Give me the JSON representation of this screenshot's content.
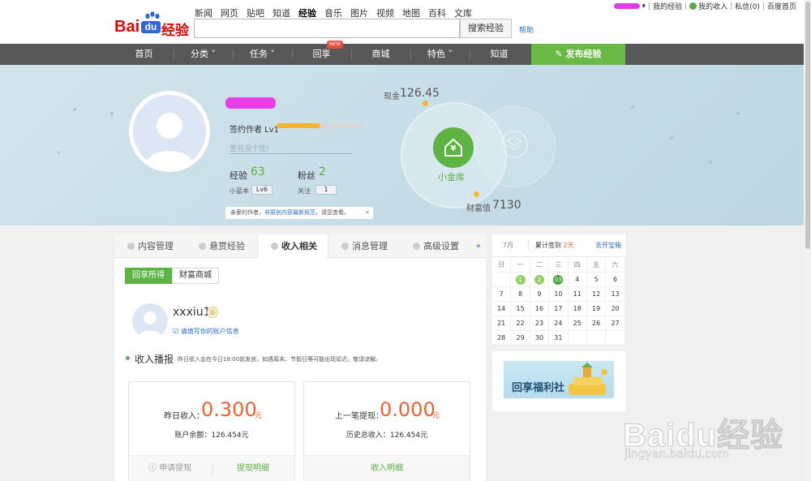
{
  "header": {
    "logo": {
      "bai": "Bai",
      "du": "du",
      "jingyan": "经验"
    },
    "nav_links": [
      "新闻",
      "网页",
      "贴吧",
      "知道",
      "经验",
      "音乐",
      "图片",
      "视频",
      "地图",
      "百科",
      "文库"
    ],
    "active_link": "经验",
    "search_placeholder": "",
    "search_button": "搜索经验",
    "help": "帮助",
    "user_links": [
      "我的经验",
      "我的收入",
      "私信(0)",
      "百度首页"
    ]
  },
  "main_nav": {
    "items": [
      "首页",
      "分类",
      "任务",
      "回享",
      "商城",
      "特色",
      "知道"
    ],
    "dropdown_marker": "˅",
    "new_badge": "NEW",
    "publish": "发布经验"
  },
  "profile": {
    "level_label": "签约作者 Lv1",
    "level_progress": 0.5,
    "signature_placeholder": "签名没个性!",
    "exp_label": "经验",
    "exp_value": "63",
    "fans_label": "粉丝",
    "fans_value": "2",
    "blue_label": "小蓝本",
    "blue_value": "Lv6",
    "follow_label": "关注",
    "follow_value": "1",
    "notice_prefix": "亲爱的作者，",
    "notice_link": "非原创内容最新规范",
    "notice_suffix": "，请您查看。",
    "notice_close": "×"
  },
  "vault": {
    "cash_label": "现金",
    "cash_value": "126.45",
    "vault_label": "小金库",
    "wealth_label": "财富值",
    "wealth_value": "7130",
    "vault_symbol": "¥"
  },
  "tabs": {
    "items": [
      "内容管理",
      "悬赏经验",
      "收入相关",
      "消息管理",
      "高级设置"
    ],
    "active": "收入相关",
    "more": "»"
  },
  "income": {
    "subtabs": [
      "回享所得",
      "财富商城"
    ],
    "username": "xxxiu1",
    "account_link": "请填写你的账户信息",
    "broadcast_title": "收入播报",
    "broadcast_note": "昨日收入会在今日18:00前发放，如遇周末、节假日等可能出现延迟，敬请谅解。",
    "card1": {
      "label": "昨日收入：",
      "value": "0.300",
      "unit": "元",
      "sub": "账户余额：126.454元",
      "btn1": "申请提现",
      "btn2": "提现明细"
    },
    "card2": {
      "label": "上一笔提现：",
      "value": "0.000",
      "unit": "元",
      "sub": "历史总收入：126.454元",
      "btn1": "收入明细"
    }
  },
  "calendar": {
    "month": "7月",
    "streak_prefix": "累计签到",
    "streak_days": "2天",
    "open_box": "去开宝箱",
    "weekdays": [
      "日",
      "一",
      "二",
      "三",
      "四",
      "五",
      "六"
    ],
    "weeks": [
      [
        "",
        "1",
        "2",
        "03",
        "4",
        "5",
        "6"
      ],
      [
        "7",
        "8",
        "9",
        "10",
        "11",
        "12",
        "13"
      ],
      [
        "14",
        "15",
        "16",
        "17",
        "18",
        "19",
        "20"
      ],
      [
        "21",
        "22",
        "23",
        "24",
        "25",
        "26",
        "27"
      ],
      [
        "28",
        "29",
        "30",
        "31",
        "",
        "",
        ""
      ]
    ],
    "signed_days": [
      "1",
      "2"
    ],
    "today": "03"
  },
  "promo": {
    "title": "回享福利社"
  },
  "watermark": {
    "text": "Baidu经验",
    "url": "jingyan.baidu.com"
  },
  "colors": {
    "accent_green": "#5cb443",
    "brand_red": "#e10602",
    "nav_dark": "#585858",
    "money_orange": "#f06132",
    "link_blue": "#2a6ec1"
  }
}
